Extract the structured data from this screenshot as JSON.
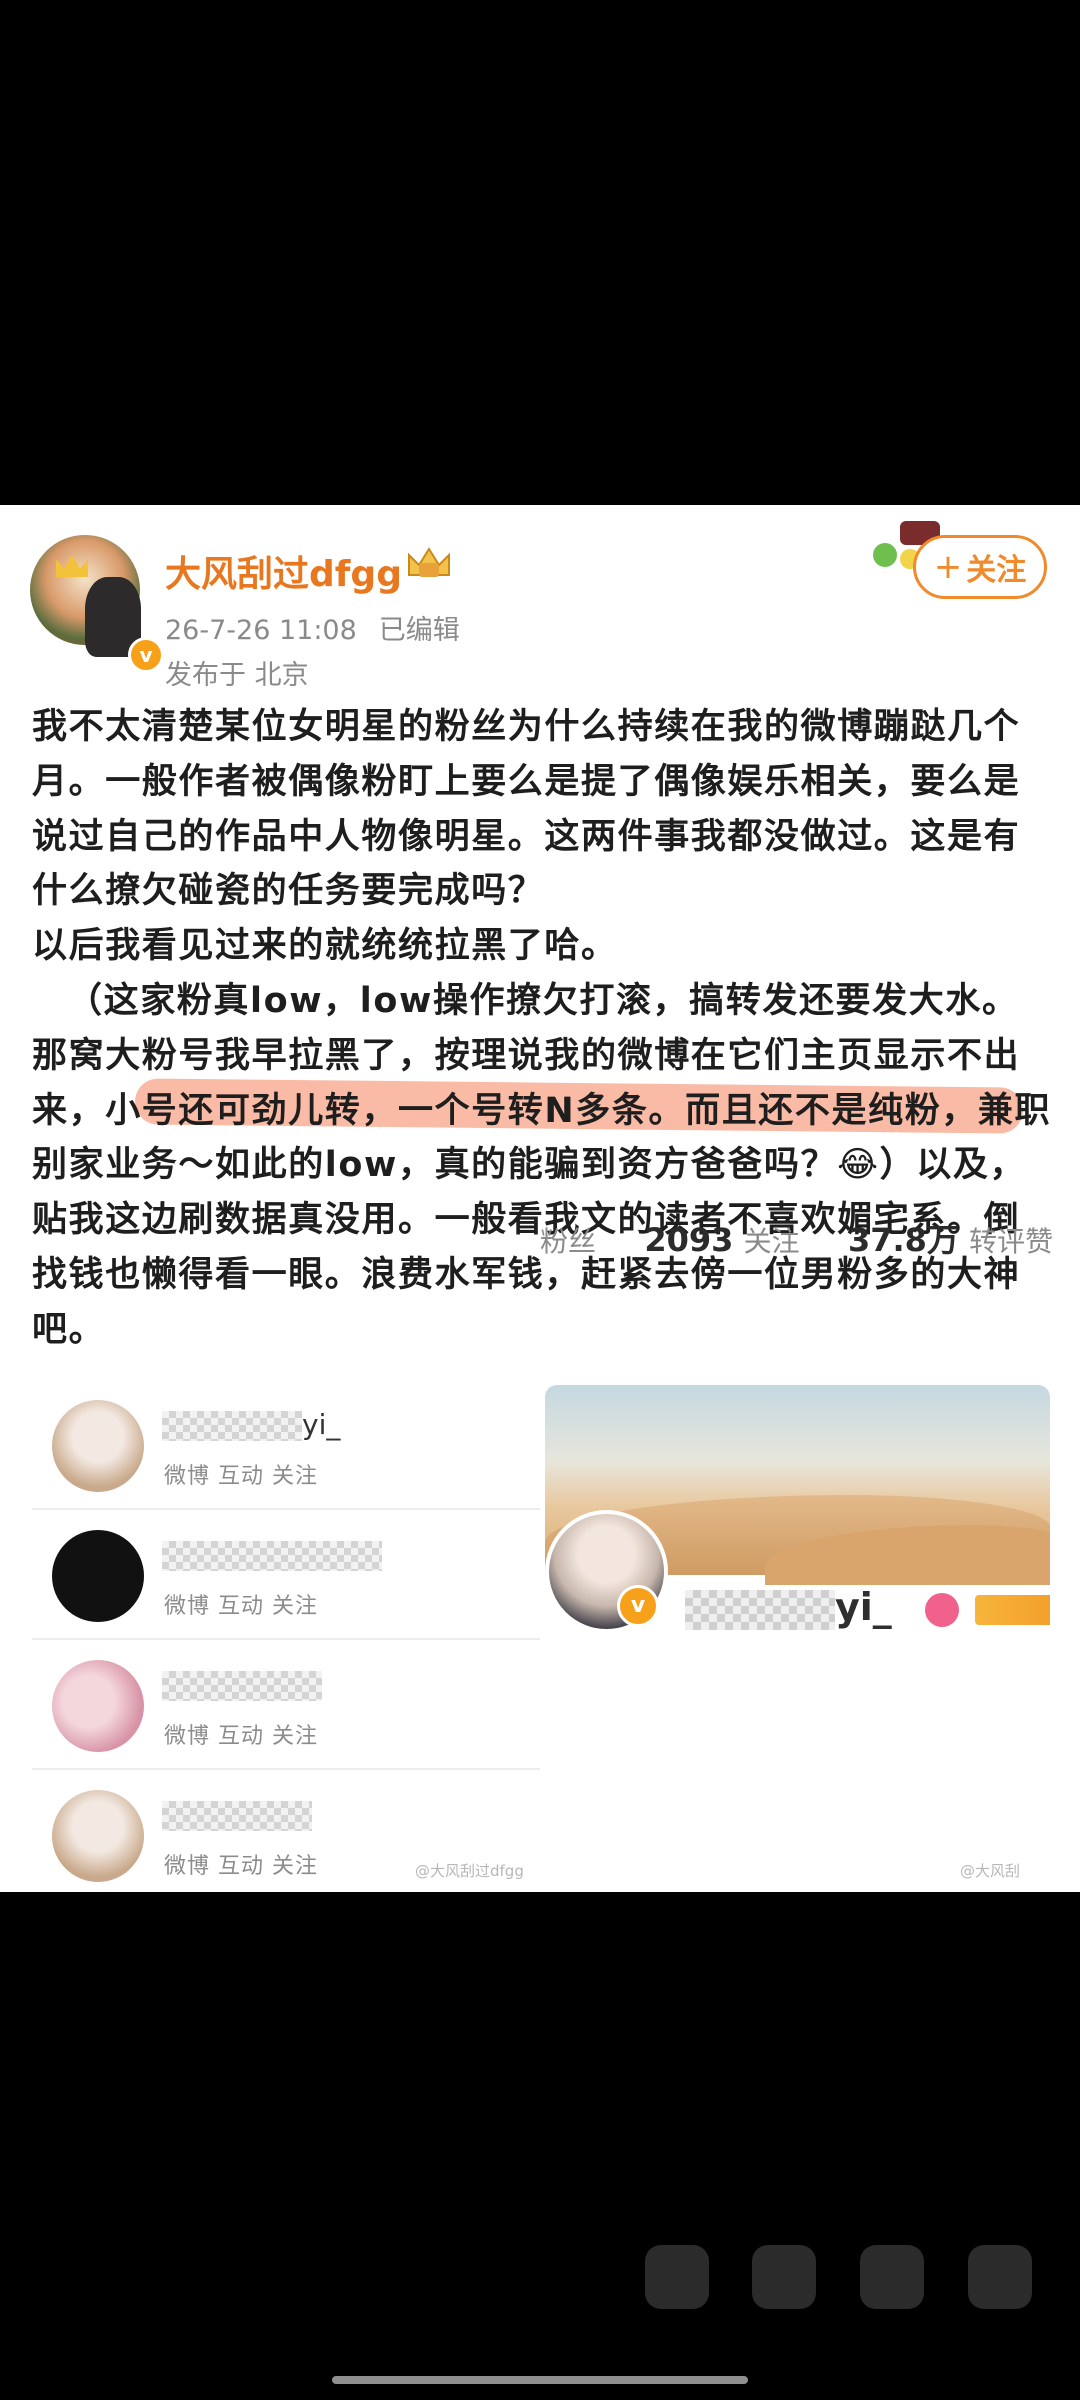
{
  "post": {
    "username": "大风刮过dfgg",
    "time": "26-7-26 11:08",
    "edited": "已编辑",
    "location": "发布于 北京",
    "follow_label": "关注",
    "paragraphs": [
      "我不太清楚某位女明星的粉丝为什么持续在我的微博蹦跶几个月。一般作者被偶像粉盯上要么是提了偶像娱乐相关，要么是说过自己的作品中人物像明星。这两件事我都没做过。这是有什么撩欠碰瓷的任务要完成吗？",
      "以后我看见过来的就统统拉黑了哈。",
      "（这家粉真low，low操作撩欠打滚，搞转发还要发大水。那窝大粉号我早拉黑了，按理说我的微博在它们主页显示不出来，小号还可劲儿转，一个号转N多条。而且还不是纯粉，兼职别家业务～如此的low，真的能骗到资方爸爸吗？😂）以及，贴我这边刷数据真没用。一般看我文的读者不喜欢媚宅系。倒找钱也懒得看一眼。浪费水军钱，赶紧去傍一位男粉多的大神吧。"
    ]
  },
  "list": {
    "rows": [
      {
        "name": "yi_",
        "sub": "微博 互动 关注"
      },
      {
        "name": "",
        "sub": "微博 互动 关注"
      },
      {
        "name": "",
        "sub": "微博 互动 关注"
      },
      {
        "name": "",
        "sub": "微博 互动 关注"
      }
    ],
    "watermark": "@大风刮过dfgg"
  },
  "profile": {
    "name_suffix": "yi_",
    "fans_label": "粉丝",
    "following_count": "2093",
    "following_label": "关注",
    "reposts_count": "37.8万",
    "reposts_label": "转评赞",
    "watermark": "@大风刮"
  }
}
